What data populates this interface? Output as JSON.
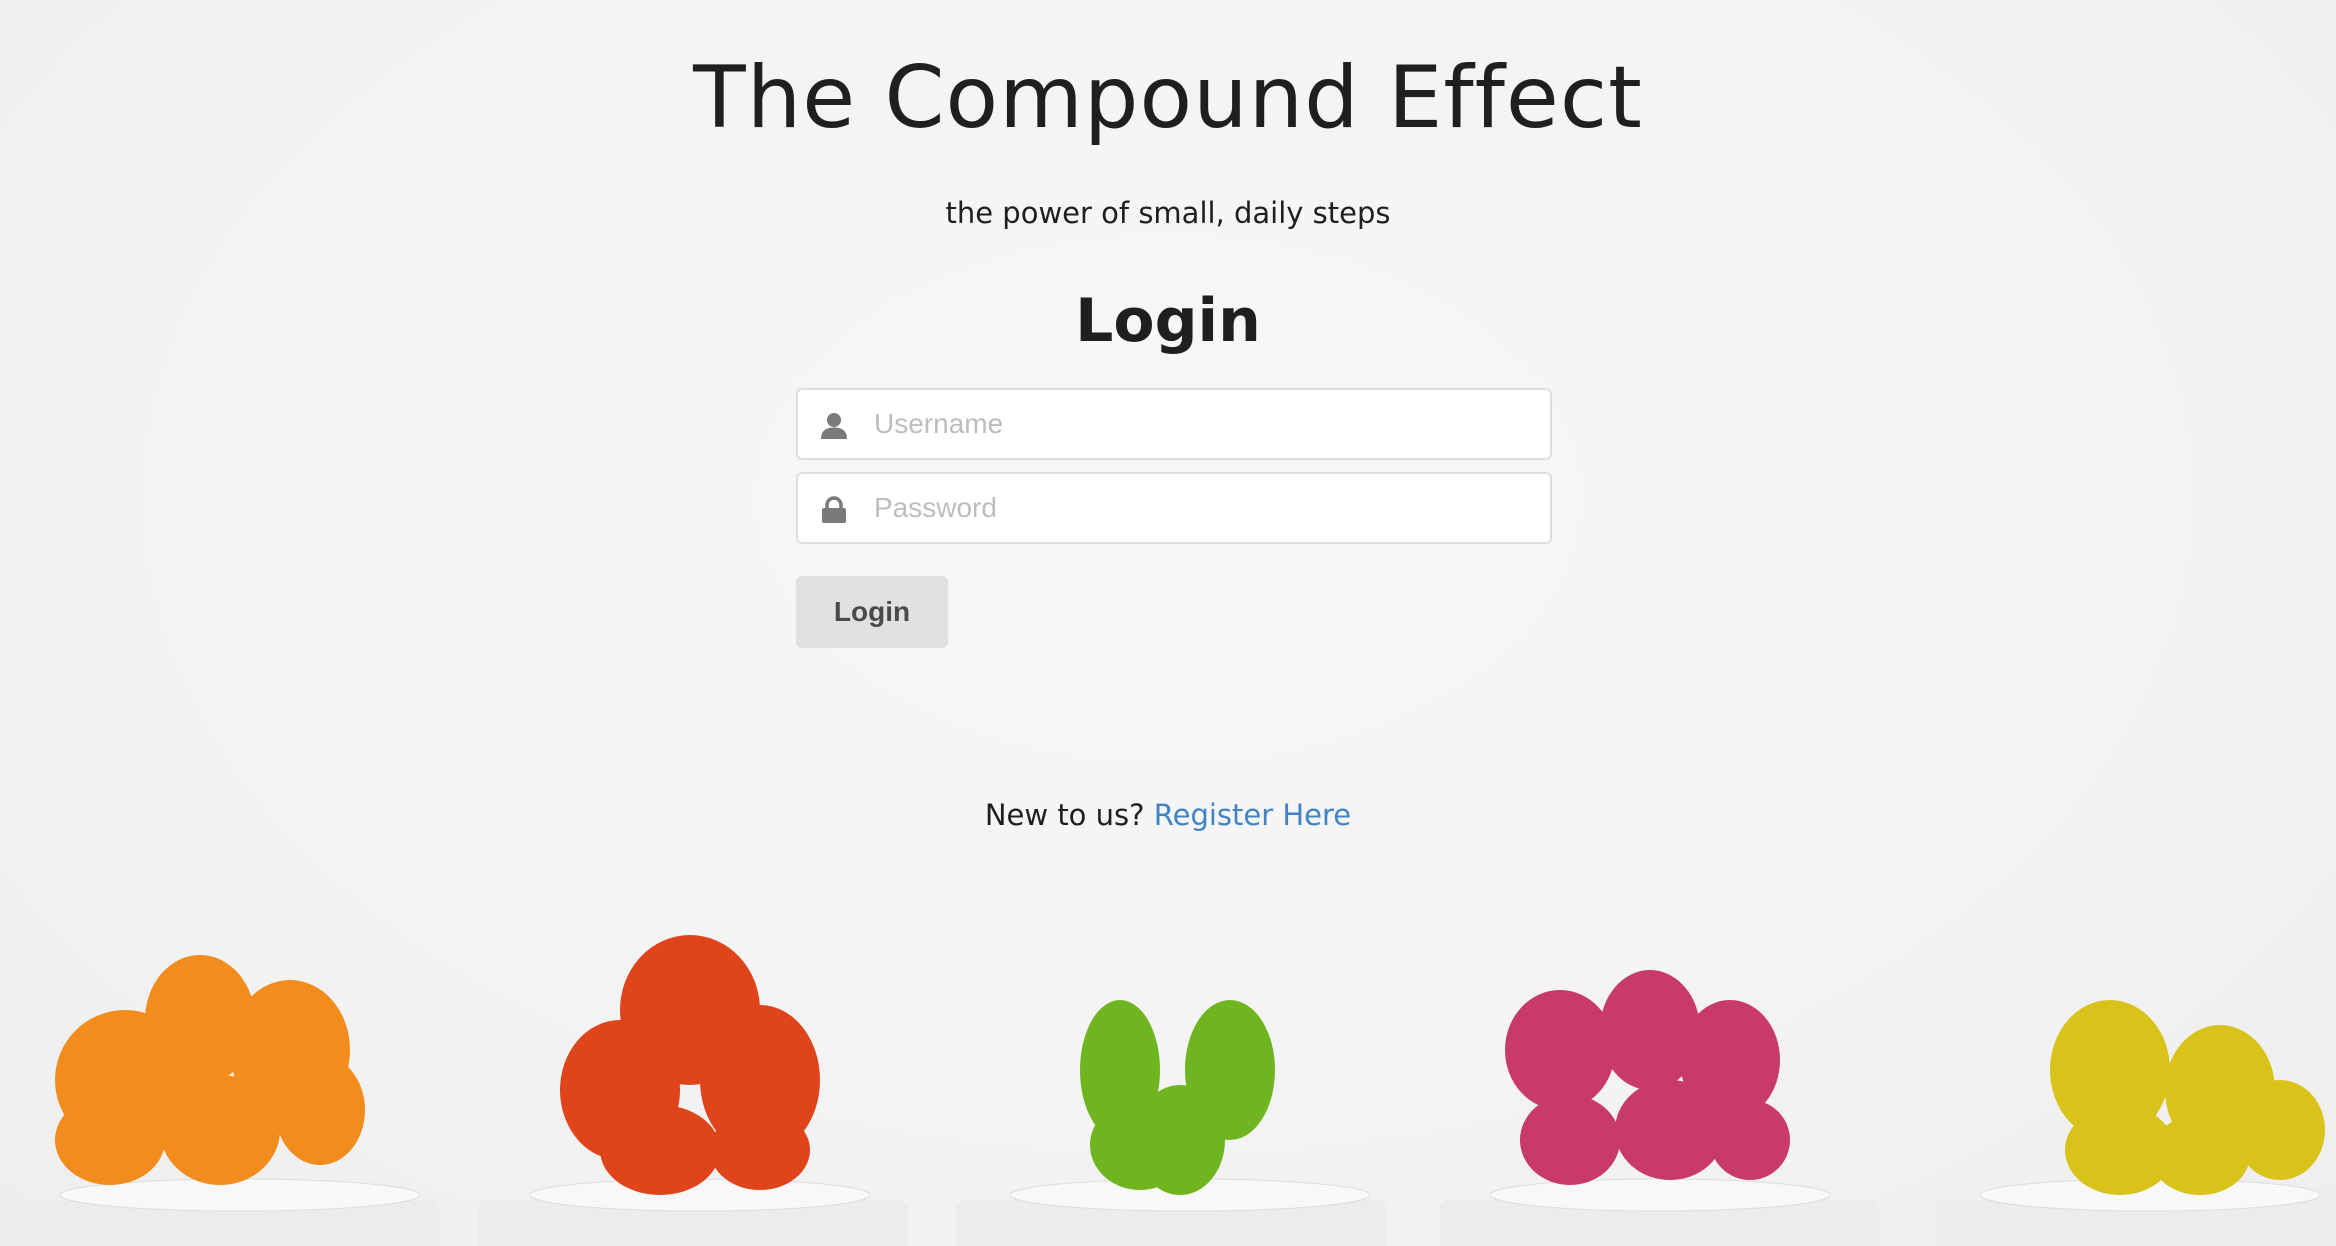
{
  "header": {
    "title": "The Compound Effect",
    "tagline": "the power of small, daily steps"
  },
  "login_form": {
    "heading": "Login",
    "username_placeholder": "Username",
    "username_value": "",
    "password_placeholder": "Password",
    "password_value": "",
    "submit_label": "Login"
  },
  "footer": {
    "prompt": "New to us?",
    "register_link": "Register Here"
  },
  "colors": {
    "link": "#4183c4",
    "button_bg": "#e0e1e2",
    "text": "#1f1f1f"
  },
  "icons": {
    "username": "user-icon",
    "password": "lock-icon"
  },
  "background": {
    "plant_colors": [
      "#f28c1c",
      "#e0441a",
      "#6fb51f",
      "#c83a6a",
      "#d9c21a"
    ]
  }
}
